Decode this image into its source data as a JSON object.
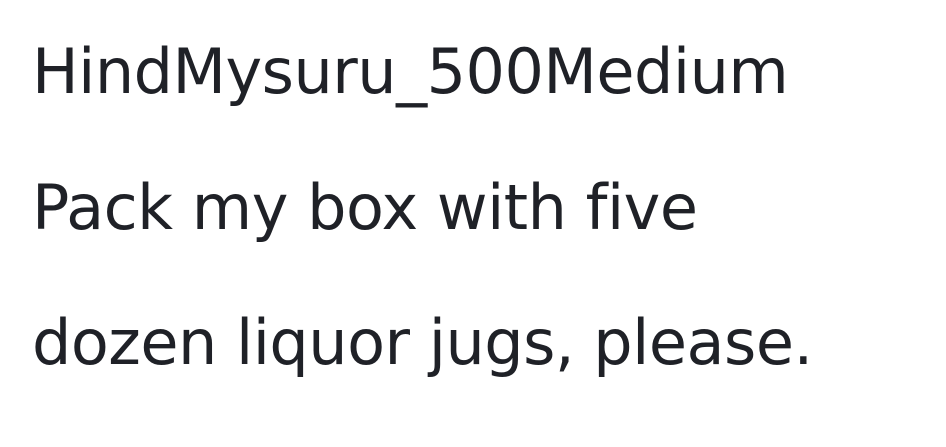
{
  "specimen": {
    "font_name": "HindMysuru_500Medium",
    "sample_line_1": "Pack my box with five",
    "sample_line_2": "dozen liquor jugs, please."
  },
  "colors": {
    "background": "#ffffff",
    "text": "#1f2127"
  }
}
